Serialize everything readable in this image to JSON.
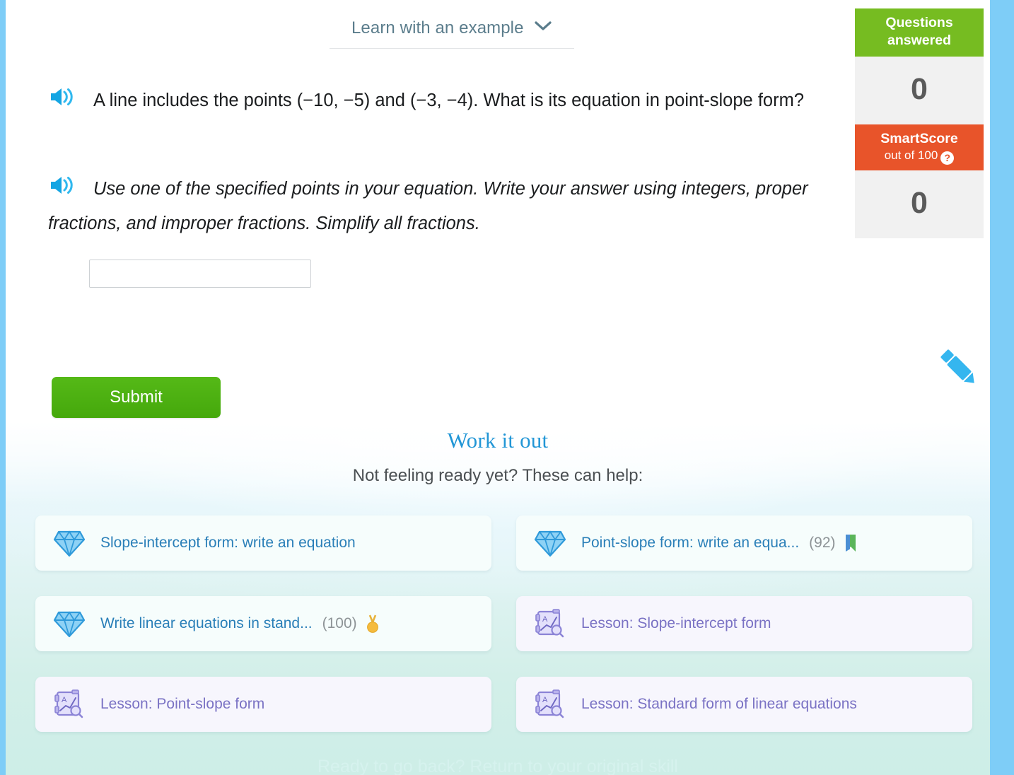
{
  "header": {
    "example_label": "Learn with an example",
    "chevron_icon": "chevron-down-icon"
  },
  "question": {
    "speaker_icon": "speaker-icon",
    "text": "A line includes the points (−10, −5) and (−3, −4). What is its equation in point-slope form?",
    "points": [
      [
        -10,
        -5
      ],
      [
        -3,
        -4
      ]
    ],
    "form": "point-slope form"
  },
  "directions": {
    "speaker_icon": "speaker-icon",
    "text": "Use one of the specified points in your equation. Write your answer using integers, proper fractions, and improper fractions. Simplify all fractions."
  },
  "answer": {
    "value": "",
    "placeholder": ""
  },
  "submit": {
    "label": "Submit"
  },
  "pencil": {
    "icon": "pencil-icon",
    "color": "#35b6ef"
  },
  "scorepanel": {
    "questions_answered": {
      "title_line1": "Questions",
      "title_line2": "answered",
      "value": "0",
      "color": "#76bc21"
    },
    "smartscore": {
      "title": "SmartScore",
      "subtitle": "out of 100",
      "help_icon": "question-mark-icon",
      "value": "0",
      "color": "#e8542a"
    }
  },
  "workitout": {
    "title": "Work it out",
    "subtitle": "Not feeling ready yet? These can help:",
    "recommendations": [
      {
        "label": "Slope-intercept form: write an equation",
        "icon": "diamond-icon",
        "kind": "skill",
        "score": "",
        "badge": ""
      },
      {
        "label": "Point-slope form: write an equa...",
        "icon": "diamond-icon",
        "kind": "skill",
        "score": "(92)",
        "badge": "bookmark-ribbon-icon"
      },
      {
        "label": "Write linear equations in stand...",
        "icon": "diamond-icon",
        "kind": "skill",
        "score": "(100)",
        "badge": "gold-medal-icon"
      },
      {
        "label": "Lesson: Slope-intercept form",
        "icon": "lesson-icon",
        "kind": "lesson",
        "score": "",
        "badge": ""
      },
      {
        "label": "Lesson: Point-slope form",
        "icon": "lesson-icon",
        "kind": "lesson",
        "score": "",
        "badge": ""
      },
      {
        "label": "Lesson: Standard form of linear equations",
        "icon": "lesson-icon",
        "kind": "lesson",
        "score": "",
        "badge": ""
      }
    ]
  },
  "footer": {
    "return_text": "Ready to go back? Return to your original skill"
  }
}
